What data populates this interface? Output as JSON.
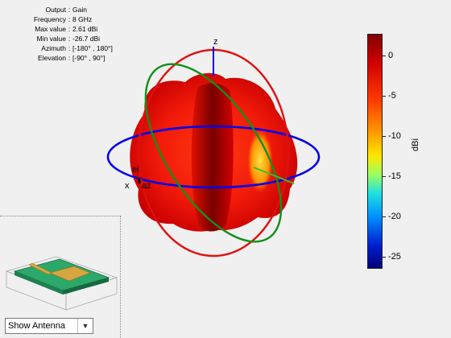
{
  "info": [
    {
      "key": "Output",
      "value": "Gain"
    },
    {
      "key": "Frequency",
      "value": "8 GHz"
    },
    {
      "key": "Max value",
      "value": "2.61 dBi"
    },
    {
      "key": "Min value",
      "value": "-26.7 dBi"
    },
    {
      "key": "Azimuth",
      "value": "[-180° , 180°]"
    },
    {
      "key": "Elevation",
      "value": "[-90° , 90°]"
    }
  ],
  "axes": {
    "z": "z",
    "x": "x",
    "az": "az",
    "el": "el"
  },
  "colorbar": {
    "unit": "dBi",
    "ticks": [
      "0",
      "-5",
      "-10",
      "-15",
      "-20",
      "-25"
    ],
    "max": 2.61,
    "min": -26.7
  },
  "control": {
    "select_value": "Show Antenna"
  }
}
